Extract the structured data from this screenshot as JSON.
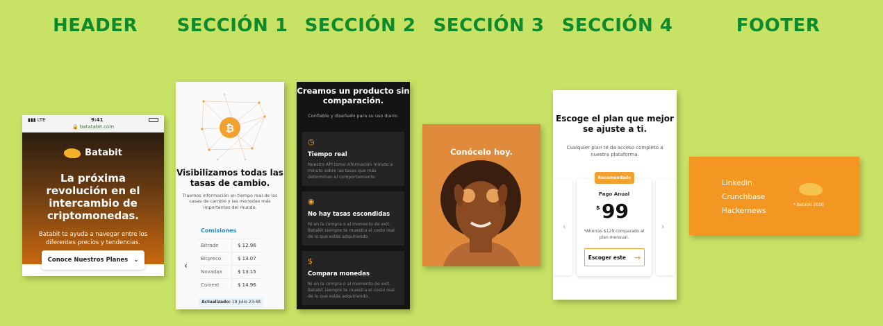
{
  "columns": [
    "HEADER",
    "SECCIÓN 1",
    "SECCIÓN 2",
    "SECCIÓN 3",
    "SECCIÓN 4",
    "FOOTER"
  ],
  "colors": {
    "background": "#c8e265",
    "title": "#0f8a2b",
    "accent": "#f2a12e",
    "footer": "#f39722"
  },
  "header": {
    "carrier": "LTE",
    "time": "9:41",
    "url": "batatabit.com",
    "brand": "Batabit",
    "headline": "La próxima revolución en el intercambio de criptomonedas.",
    "description": "Batabit te ayuda a navegar entre los diferentes precios y tendencias.",
    "cta_label": "Conoce Nuestros Planes"
  },
  "section1": {
    "title": "Visibilizamos todas las tasas de cambio.",
    "description": "Traemos información en tiempo real de las casas de cambio y las monedas más importantes del mundo.",
    "table_header": "Comisiones",
    "rows": [
      {
        "name": "Bitrade",
        "value": "$ 12.96"
      },
      {
        "name": "Bitpreco",
        "value": "$ 13.07"
      },
      {
        "name": "Novadax",
        "value": "$ 13.15"
      },
      {
        "name": "Coinext",
        "value": "$ 14.96"
      }
    ],
    "updated_label": "Actualizado:",
    "updated_date": "19 Julio 23:48"
  },
  "section2": {
    "title": "Creamos un producto sin comparación.",
    "subtitle": "Confiable y diseñado para su uso diario.",
    "features": [
      {
        "icon": "clock-icon",
        "title": "Tiempo real",
        "text": "Nuestro API toma información minuto a minuto sobre las tasas que más determinan el comportamiento."
      },
      {
        "icon": "eye-icon",
        "title": "No hay tasas escondidas",
        "text": "Ni en la compra o al momento de exit. Batabit siempre te muestra el costo real de lo que estás adquiriendo."
      },
      {
        "icon": "dollar-icon",
        "title": "Compara monedas",
        "text": "Ni en la compra o al momento de exit. Batabit siempre te muestra el costo real de lo que estás adquiriendo."
      }
    ]
  },
  "section3": {
    "title": "Conócelo hoy."
  },
  "section4": {
    "title": "Escoge el plan que mejor se ajuste a ti.",
    "description": "Cualquier plan te da acceso completo a nuestra plataforma.",
    "badge": "Recomendado",
    "plan_name": "Pago Anual",
    "currency": "$",
    "price": "99",
    "note": "*Ahorras $129 comparado al plan mensual.",
    "button_label": "Escoger este"
  },
  "footer": {
    "links": [
      "Linkedin",
      "Crunchbase",
      "Hackernews"
    ],
    "copyright": "* Batabit 2020"
  }
}
